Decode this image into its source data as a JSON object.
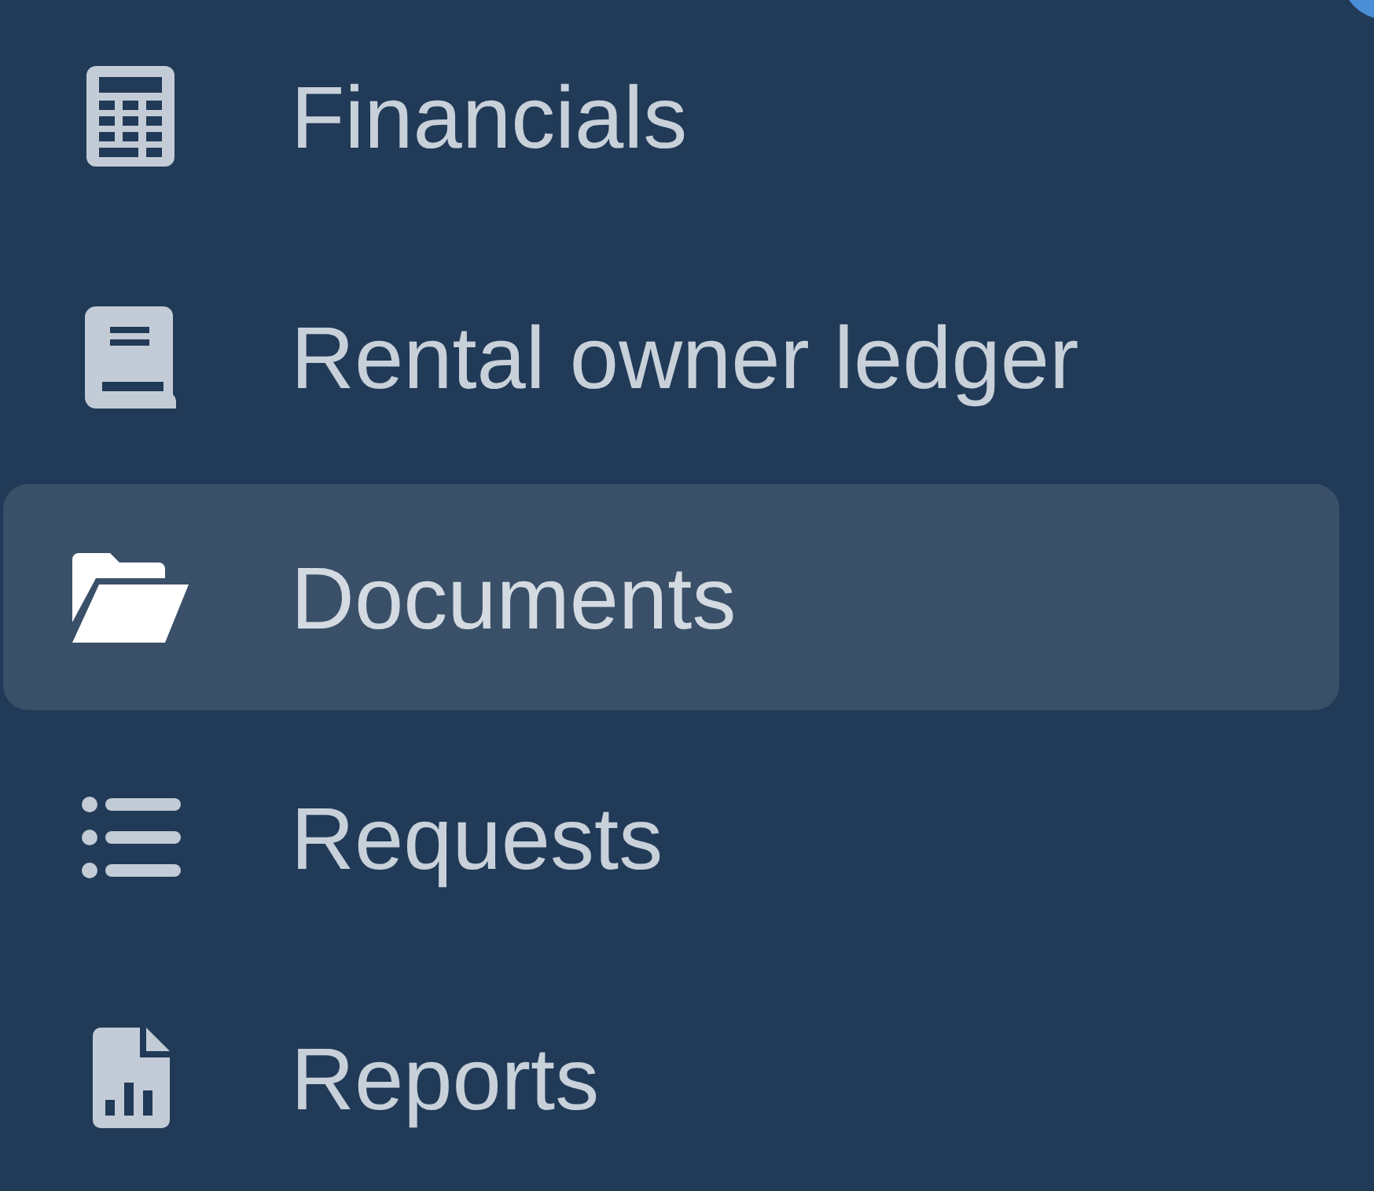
{
  "sidebar": {
    "items": [
      {
        "label": "Financials",
        "selected": false
      },
      {
        "label": "Rental owner ledger",
        "selected": false
      },
      {
        "label": "Documents",
        "selected": true
      },
      {
        "label": "Requests",
        "selected": false
      },
      {
        "label": "Reports",
        "selected": false
      }
    ]
  }
}
